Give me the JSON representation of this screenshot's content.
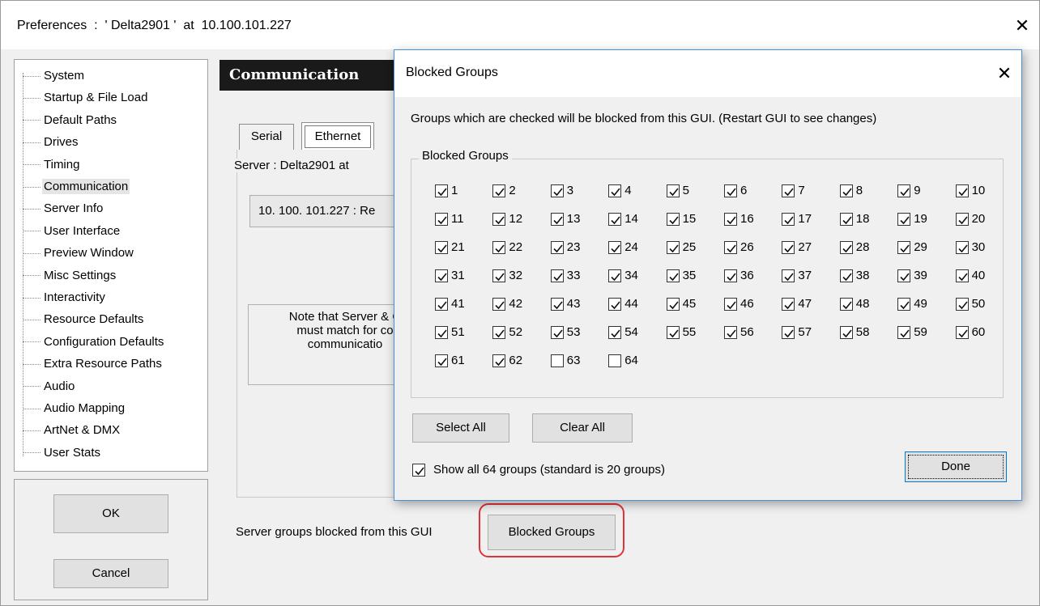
{
  "window": {
    "title": "Preferences  :  ' Delta2901 '  at  10.100.101.227",
    "close_glyph": "✕"
  },
  "tree": {
    "items": [
      "System",
      "Startup & File Load",
      "Default Paths",
      "Drives",
      "Timing",
      "Communication",
      "Server Info",
      "User Interface",
      "Preview Window",
      "Misc Settings",
      "Interactivity",
      "Resource Defaults",
      "Configuration Defaults",
      "Extra Resource Paths",
      "Audio",
      "Audio Mapping",
      "ArtNet & DMX",
      "User Stats"
    ],
    "selected_index": 5
  },
  "buttons": {
    "ok": "OK",
    "cancel": "Cancel",
    "blocked_groups": "Blocked Groups"
  },
  "communication": {
    "header": "Communication",
    "tabs": [
      "Serial",
      "Ethernet"
    ],
    "active_tab": "Ethernet",
    "server_label": "Server : Delta2901  at",
    "ip_text": "10. 100. 101.227 : Re",
    "note_lines": [
      "Note that Server & C",
      "must match for co",
      "communicatio"
    ],
    "blocked_label": "Server groups blocked from this GUI"
  },
  "dialog": {
    "title": "Blocked Groups",
    "close_glyph": "✕",
    "description": "Groups which are checked will be blocked from this GUI.  (Restart GUI to see changes)",
    "frame_label": "Blocked Groups",
    "groups": {
      "count": 64,
      "unchecked": [
        63,
        64
      ]
    },
    "select_all": "Select All",
    "clear_all": "Clear All",
    "show_all_label": "Show all 64 groups (standard is 20 groups)",
    "show_all_checked": true,
    "done": "Done"
  },
  "colors": {
    "highlight_ring": "#e0323a",
    "dialog_border": "#4a90d9",
    "header_bg": "#1a1a1a"
  }
}
